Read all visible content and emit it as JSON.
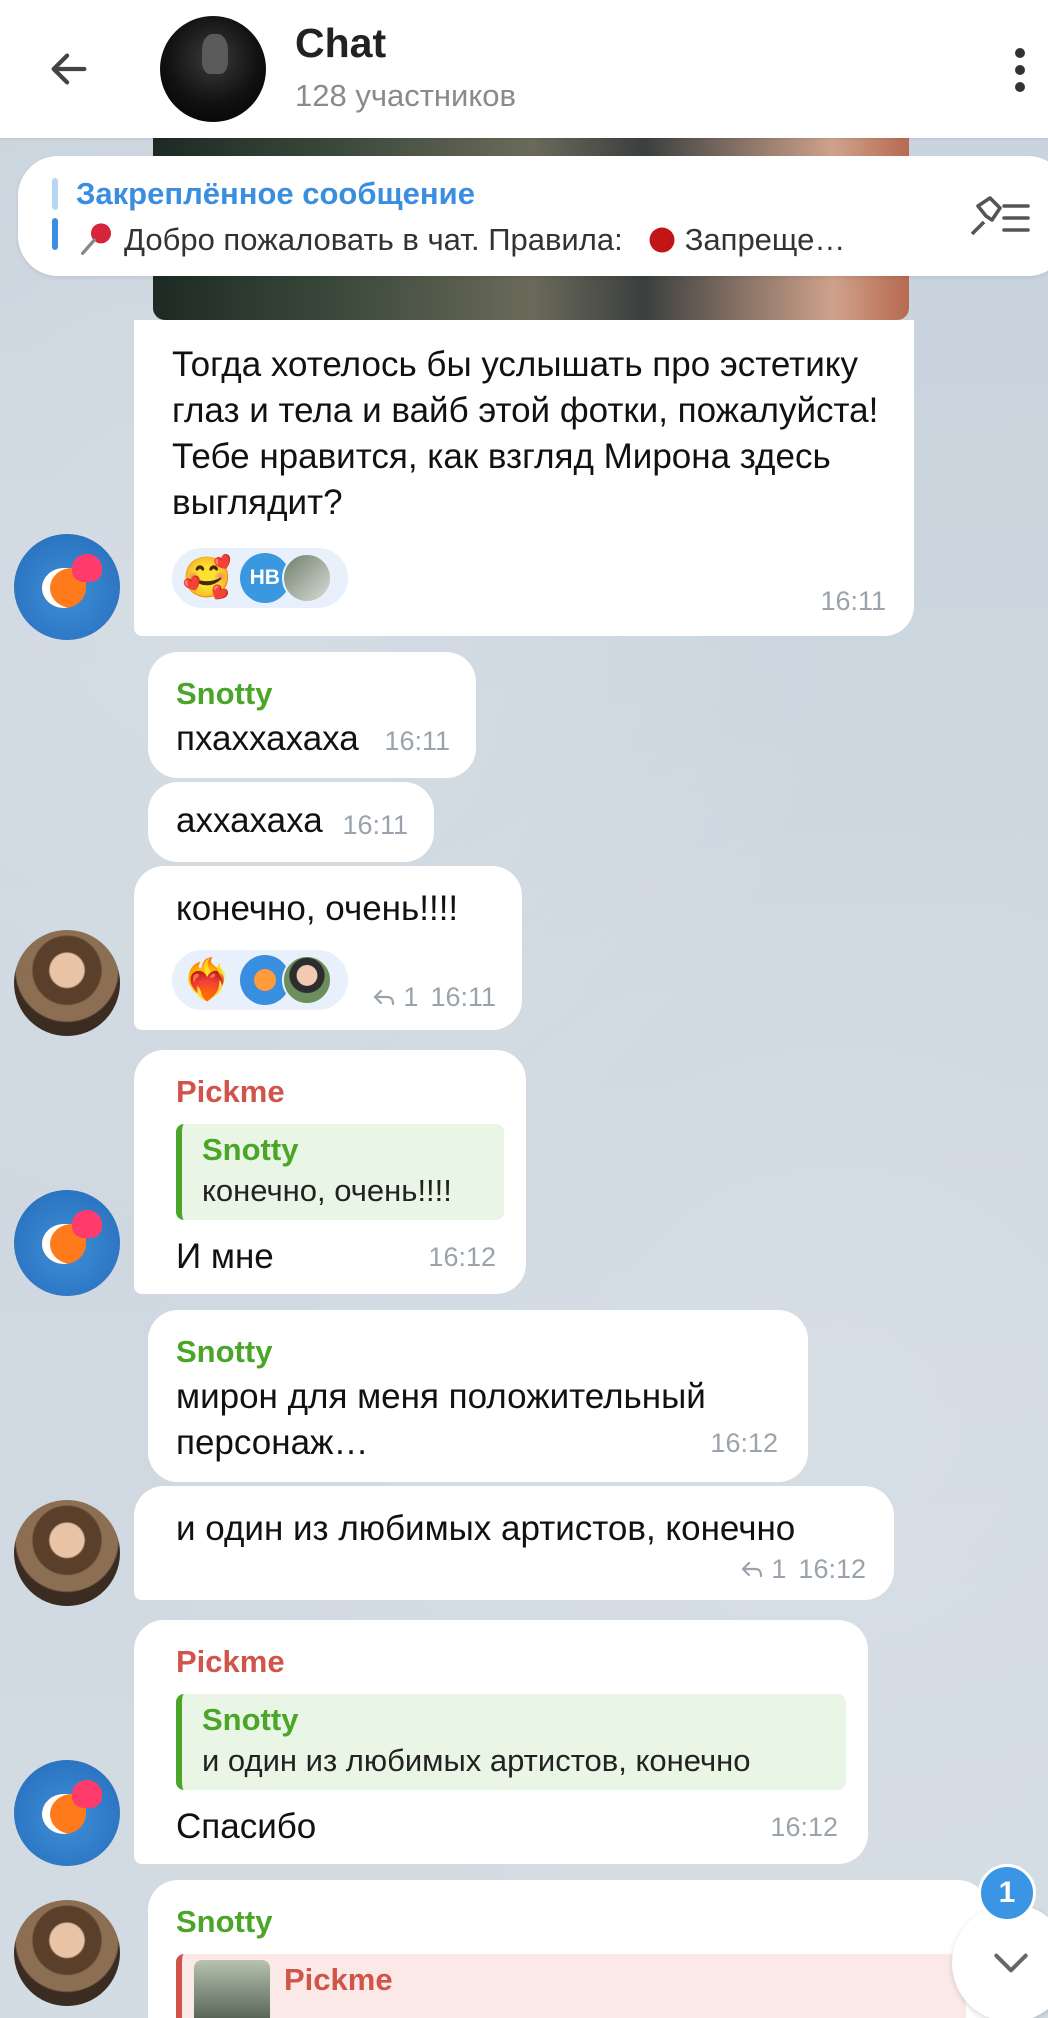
{
  "header": {
    "title": "Chat",
    "subtitle": "128 участников"
  },
  "pinned": {
    "title": "Закреплённое сообщение",
    "text_before": "Добро пожаловать в чат. Правила:",
    "text_after": "Запреще…"
  },
  "messages": [
    {
      "text": "Тогда хотелось бы услышать про эстетику глаз и тела и вайб этой фотки, пожалуйста!Тебе нравится, как взгляд Мирона здесь выглядит?",
      "time": "16:11",
      "reaction_badge": "НВ"
    },
    {
      "sender": "Snotty",
      "text": "пхаххахаха",
      "time": "16:11"
    },
    {
      "text": "аххахаха",
      "time": "16:11"
    },
    {
      "text": "конечно, очень!!!!",
      "time": "16:11",
      "reply_count": "1"
    },
    {
      "sender": "Pickme",
      "quote_name": "Snotty",
      "quote_text": "конечно, очень!!!!",
      "text": "И мне",
      "time": "16:12"
    },
    {
      "sender": "Snotty",
      "text_line1": "мирон для меня положительный",
      "text_line2": "персонаж…",
      "time": "16:12"
    },
    {
      "text": "и один из любимых артистов, конечно",
      "time": "16:12",
      "reply_count": "1"
    },
    {
      "sender": "Pickme",
      "quote_name": "Snotty",
      "quote_text": "и один из любимых артистов, конечно",
      "text": "Спасибо",
      "time": "16:12"
    },
    {
      "sender": "Snotty",
      "quote_name": "Pickme"
    }
  ],
  "scroll_badge": "1",
  "colors": {
    "accent": "#3a8ee0",
    "sender_green": "#4aa528",
    "sender_red": "#d0544a",
    "background": "#cdd6df"
  }
}
